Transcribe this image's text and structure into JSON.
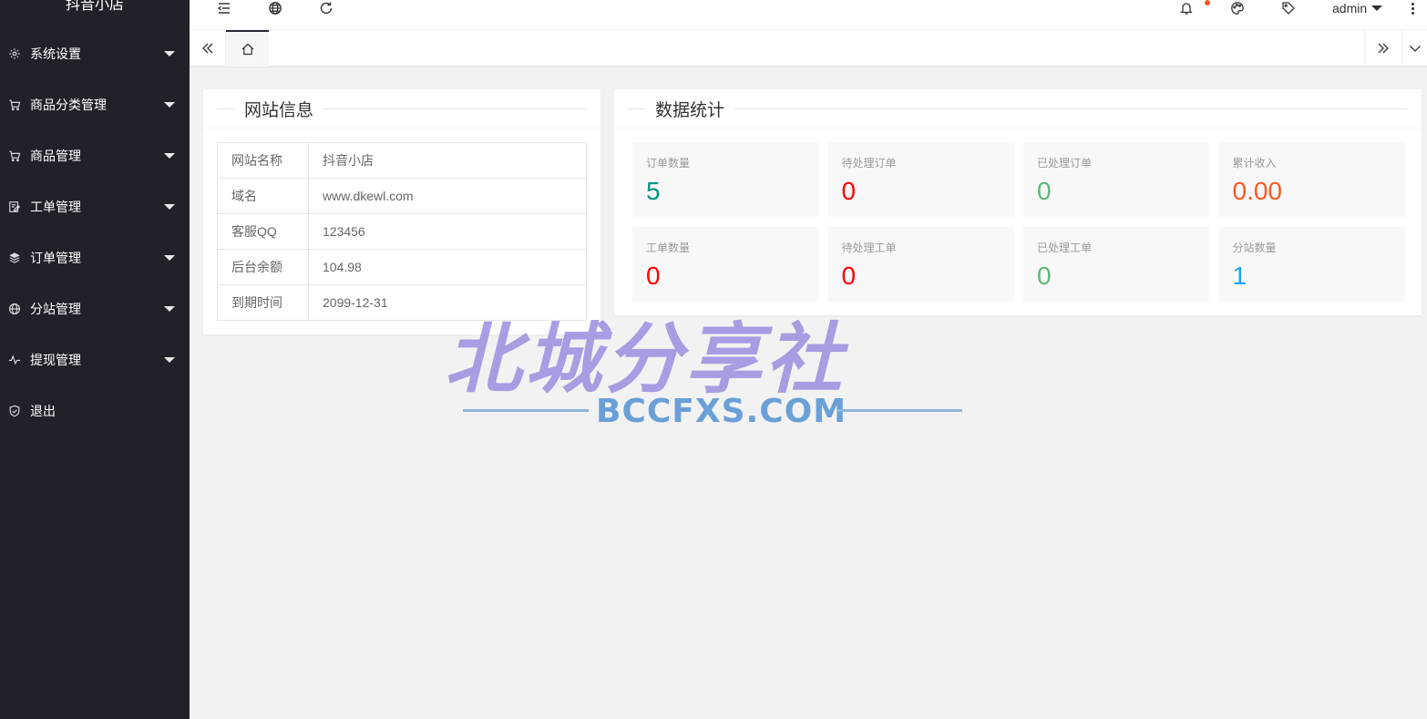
{
  "app": {
    "title": "抖音小店"
  },
  "sidebar": {
    "items": [
      {
        "label": "系统设置",
        "icon": "gear-icon",
        "has_caret": true
      },
      {
        "label": "商品分类管理",
        "icon": "cart-icon",
        "has_caret": true
      },
      {
        "label": "商品管理",
        "icon": "cart-icon",
        "has_caret": true
      },
      {
        "label": "工单管理",
        "icon": "form-icon",
        "has_caret": true
      },
      {
        "label": "订单管理",
        "icon": "layers-icon",
        "has_caret": true
      },
      {
        "label": "分站管理",
        "icon": "globe-icon",
        "has_caret": true
      },
      {
        "label": "提现管理",
        "icon": "pulse-icon",
        "has_caret": true
      },
      {
        "label": "退出",
        "icon": "shield-icon",
        "has_caret": false
      }
    ]
  },
  "header": {
    "user": "admin",
    "icons": [
      "menu-fold-icon",
      "globe-icon",
      "refresh-icon",
      "bell-icon",
      "palette-icon",
      "tag-icon",
      "more-icon"
    ],
    "notify_color": "#ff5722"
  },
  "tabs": {
    "icons": [
      "double-left-icon",
      "home-icon",
      "double-right-icon",
      "chevron-down-icon"
    ]
  },
  "site_info": {
    "title": "网站信息",
    "rows": [
      {
        "key": "网站名称",
        "value": "抖音小店"
      },
      {
        "key": "域名",
        "value": "www.dkewl.com"
      },
      {
        "key": "客服QQ",
        "value": "123456"
      },
      {
        "key": "后台余额",
        "value": "104.98"
      },
      {
        "key": "到期时间",
        "value": "2099-12-31"
      }
    ]
  },
  "stats": {
    "title": "数据统计",
    "items": [
      {
        "label": "订单数量",
        "value": "5",
        "color": "#009688"
      },
      {
        "label": "待处理订单",
        "value": "0",
        "color": "#ff0000"
      },
      {
        "label": "已处理订单",
        "value": "0",
        "color": "#5fb878"
      },
      {
        "label": "累计收入",
        "value": "0.00",
        "color": "#ff5722"
      },
      {
        "label": "工单数量",
        "value": "0",
        "color": "#ff0000"
      },
      {
        "label": "待处理工单",
        "value": "0",
        "color": "#ff0000"
      },
      {
        "label": "已处理工单",
        "value": "0",
        "color": "#5fb878"
      },
      {
        "label": "分站数量",
        "value": "1",
        "color": "#1e9fff"
      }
    ]
  },
  "watermark": {
    "chinese": "北城分享社",
    "english": "BCCFXS.COM"
  }
}
